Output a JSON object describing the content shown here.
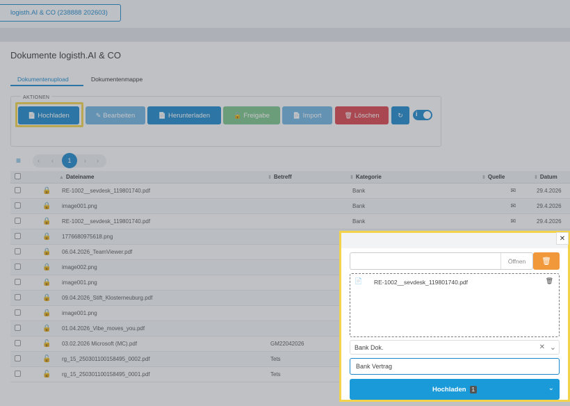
{
  "header": {
    "company_button": "logisth.AI & CO (238888 202603)"
  },
  "page": {
    "title": "Dokumente logisth.AI & CO"
  },
  "tabs": [
    {
      "label": "Dokumentenupload"
    },
    {
      "label": "Dokumentenmappe"
    }
  ],
  "actions": {
    "label": "AKTIONEN",
    "buttons": [
      {
        "label": "Hochladen",
        "icon": "file-icon",
        "color": "#1a86c9"
      },
      {
        "label": "Bearbeiten",
        "icon": "edit-icon",
        "color": "#6eb3e0"
      },
      {
        "label": "Herunterladen",
        "icon": "download-icon",
        "color": "#1a86c9"
      },
      {
        "label": "Freigabe",
        "icon": "unlock-icon",
        "color": "#7cc489"
      },
      {
        "label": "Import",
        "icon": "import-icon",
        "color": "#6eb3e0"
      },
      {
        "label": "Löschen",
        "icon": "trash-icon",
        "color": "#d9414a"
      }
    ],
    "refresh_icon": "refresh-icon",
    "info_toggle": "i"
  },
  "pagination": {
    "current": "1"
  },
  "table": {
    "columns": [
      "Dateiname",
      "Betreff",
      "Kategorie",
      "Quelle",
      "Datum"
    ],
    "rows": [
      {
        "lock": "locked",
        "file": "RE-1002__sevdesk_119801740.pdf",
        "subject": "",
        "category": "Bank",
        "source": "mail",
        "date": "29.4.2026"
      },
      {
        "lock": "locked",
        "file": "image001.png",
        "subject": "",
        "category": "Bank",
        "source": "mail",
        "date": "29.4.2026"
      },
      {
        "lock": "locked",
        "file": "RE-1002__sevdesk_119801740.pdf",
        "subject": "",
        "category": "Bank",
        "source": "mail",
        "date": "29.4.2026"
      },
      {
        "lock": "locked",
        "file": "1776680975618.png",
        "subject": "",
        "category": "",
        "source": "",
        "date": ""
      },
      {
        "lock": "locked",
        "file": "06.04.2026_TeamViewer.pdf",
        "subject": "",
        "category": "",
        "source": "",
        "date": ""
      },
      {
        "lock": "locked",
        "file": "image002.png",
        "subject": "",
        "category": "",
        "source": "",
        "date": ""
      },
      {
        "lock": "locked",
        "file": "image001.png",
        "subject": "",
        "category": "",
        "source": "",
        "date": ""
      },
      {
        "lock": "locked",
        "file": "09.04.2026_Stift_Klosterneuburg.pdf",
        "subject": "",
        "category": "",
        "source": "",
        "date": ""
      },
      {
        "lock": "locked",
        "file": "image001.png",
        "subject": "",
        "category": "",
        "source": "",
        "date": ""
      },
      {
        "lock": "locked",
        "file": "01.04.2026_Vibe_moves_you.pdf",
        "subject": "",
        "category": "",
        "source": "",
        "date": ""
      },
      {
        "lock": "unlocked",
        "file": "03.02.2026 Microsoft (MC).pdf",
        "subject": "GM22042026",
        "category": "",
        "source": "",
        "date": ""
      },
      {
        "lock": "unlocked",
        "file": "rg_15_250301100158495_0002.pdf",
        "subject": "Tets",
        "category": "",
        "source": "",
        "date": ""
      },
      {
        "lock": "unlocked",
        "file": "rg_15_250301100158495_0001.pdf",
        "subject": "Tets",
        "category": "",
        "source": "",
        "date": ""
      }
    ]
  },
  "modal": {
    "open_label": "Öffnen",
    "file_input_value": "",
    "dropzone_file": "RE-1002__sevdesk_119801740.pdf",
    "category_value": "Bank Dok.",
    "subject_value": "Bank Vertrag",
    "upload_label": "Hochladen",
    "upload_count": "1"
  }
}
